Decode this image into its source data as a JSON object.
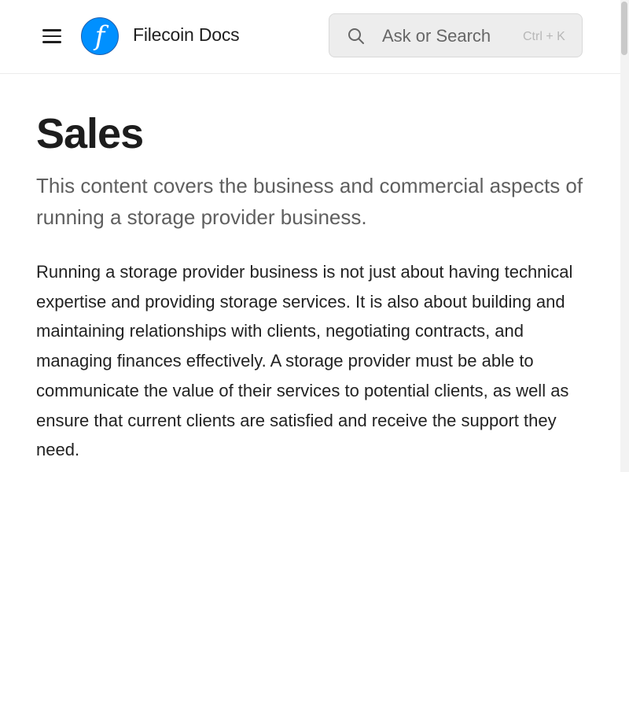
{
  "header": {
    "brand": "Filecoin Docs",
    "logo_letter": "f",
    "search": {
      "placeholder": "Ask or Search",
      "shortcut": "Ctrl + K"
    }
  },
  "page": {
    "title": "Sales",
    "subtitle": "This content covers the business and commercial aspects of running a storage provider business.",
    "body": "Running a storage provider business is not just about having technical expertise and providing storage services. It is also about building and maintaining relationships with clients, negotiating contracts, and managing finances effectively. A storage provider must be able to communicate the value of their services to potential clients, as well as ensure that current clients are satisfied and receive the support they need."
  },
  "icons": {
    "menu": "hamburger-menu-icon",
    "logo": "filecoin-logo",
    "search": "search-icon"
  },
  "colors": {
    "brand_blue": "#0090ff",
    "text_primary": "#1d1d1d",
    "text_secondary": "#5f5f5f",
    "search_background": "#ededed",
    "shortcut_text": "#b7b7b7"
  }
}
